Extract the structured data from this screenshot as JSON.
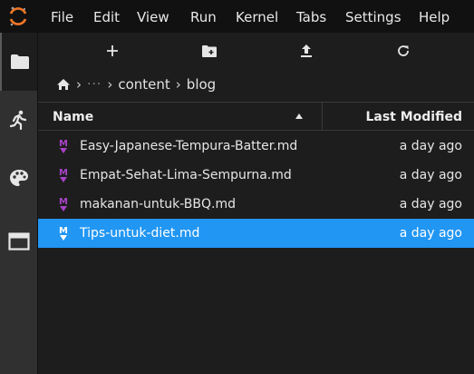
{
  "menu": {
    "items": [
      "File",
      "Edit",
      "View",
      "Run",
      "Kernel",
      "Tabs",
      "Settings",
      "Help"
    ]
  },
  "sidebar": {
    "icons": [
      "folder-icon",
      "running-icon",
      "palette-icon",
      "tabs-icon"
    ],
    "active": "folder-icon"
  },
  "toolbar": {
    "buttons": [
      "new-launcher-icon",
      "new-folder-icon",
      "upload-icon",
      "refresh-icon"
    ]
  },
  "breadcrumb": {
    "dots": "···",
    "parts": [
      "content",
      "blog"
    ]
  },
  "file_list": {
    "headers": {
      "name": "Name",
      "modified": "Last Modified"
    },
    "sort": "ascending",
    "files": [
      {
        "name": "Easy-Japanese-Tempura-Batter.md",
        "modified": "a day ago",
        "selected": false
      },
      {
        "name": "Empat-Sehat-Lima-Sempurna.md",
        "modified": "a day ago",
        "selected": false
      },
      {
        "name": "makanan-untuk-BBQ.md",
        "modified": "a day ago",
        "selected": false
      },
      {
        "name": "Tips-untuk-diet.md",
        "modified": "a day ago",
        "selected": true
      }
    ]
  },
  "colors": {
    "accent": "#2196f3",
    "logo": "#f37726",
    "markdown_icon": "#a843c7"
  }
}
